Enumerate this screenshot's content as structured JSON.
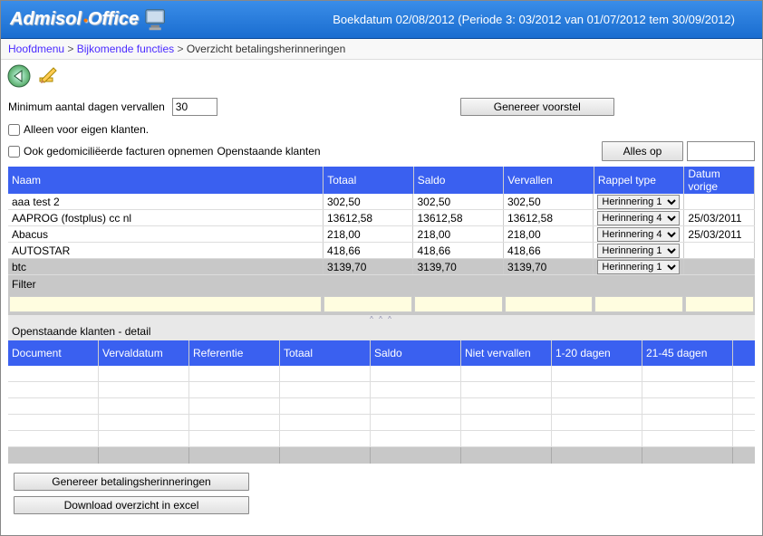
{
  "header": {
    "logo_a": "Admisol",
    "logo_b": "Office",
    "date_text": "Boekdatum 02/08/2012 (Periode 3: 03/2012 van 01/07/2012 tem 30/09/2012)"
  },
  "breadcrumb": {
    "items": [
      {
        "label": "Hoofdmenu",
        "link": true
      },
      {
        "label": "Bijkomende functies",
        "link": true
      },
      {
        "label": "Overzicht betalingsherinneringen",
        "link": false
      }
    ]
  },
  "controls": {
    "min_days_label": "Minimum aantal dagen vervallen",
    "min_days_value": "30",
    "btn_genereer_voorstel": "Genereer voorstel",
    "chk_alleen_label": "Alleen voor eigen klanten.",
    "chk_ook_label": "Ook gedomiciliëerde facturen opnemen",
    "openstaande_klanten": "Openstaande klanten",
    "btn_alles_op": "Alles op"
  },
  "grid": {
    "headers": {
      "naam": "Naam",
      "totaal": "Totaal",
      "saldo": "Saldo",
      "vervallen": "Vervallen",
      "rappel": "Rappel type",
      "datum": "Datum vorige"
    },
    "rows": [
      {
        "naam": "aaa test 2",
        "totaal": "302,50",
        "saldo": "302,50",
        "vervallen": "302,50",
        "rappel": "Herinnering 1",
        "datum": ""
      },
      {
        "naam": "AAPROG (fostplus) cc nl",
        "totaal": "13612,58",
        "saldo": "13612,58",
        "vervallen": "13612,58",
        "rappel": "Herinnering 4",
        "datum": "25/03/2011"
      },
      {
        "naam": "Abacus",
        "totaal": "218,00",
        "saldo": "218,00",
        "vervallen": "218,00",
        "rappel": "Herinnering 4",
        "datum": "25/03/2011"
      },
      {
        "naam": "AUTOSTAR",
        "totaal": "418,66",
        "saldo": "418,66",
        "vervallen": "418,66",
        "rappel": "Herinnering 1",
        "datum": ""
      },
      {
        "naam": "btc",
        "totaal": "3139,70",
        "saldo": "3139,70",
        "vervallen": "3139,70",
        "rappel": "Herinnering 1",
        "datum": "",
        "selected": true
      }
    ],
    "filter_label": "Filter"
  },
  "detail": {
    "title": "Openstaande klanten - detail",
    "headers": {
      "document": "Document",
      "vervaldatum": "Vervaldatum",
      "referentie": "Referentie",
      "totaal": "Totaal",
      "saldo": "Saldo",
      "niet_vervallen": "Niet vervallen",
      "d1_20": "1-20 dagen",
      "d21_45": "21-45 dagen"
    }
  },
  "bottom": {
    "btn_genereer_herinneringen": "Genereer betalingsherinneringen",
    "btn_download_excel": "Download overzicht in excel"
  }
}
